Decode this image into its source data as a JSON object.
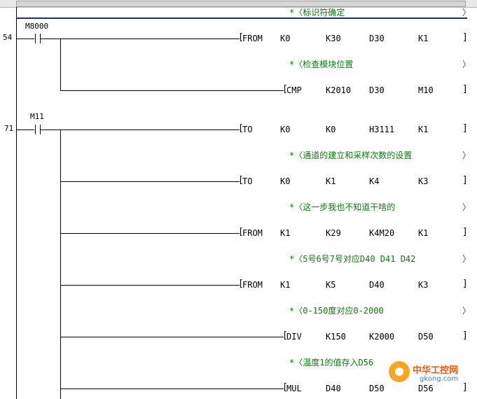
{
  "rungs": [
    {
      "step": "54",
      "contact": "M8000"
    },
    {
      "step": "71",
      "contact": "M11"
    }
  ],
  "comments": [
    "*〈标识符确定",
    "*〈检查模块位置",
    "*〈通道的建立和采样次数的设置",
    "*〈这一步我也不知道干啥的",
    "*〈5号6号7号对应D40 D41 D42",
    "*〈0-150度对应0-2000",
    "*〈温度1的值存入D56"
  ],
  "instructions": [
    {
      "op": "FROM",
      "args": [
        "K0",
        "K30",
        "D30",
        "K1"
      ]
    },
    {
      "op": "CMP",
      "args": [
        "K2010",
        "D30",
        "M10"
      ]
    },
    {
      "op": "TO",
      "args": [
        "K0",
        "K0",
        "H3111",
        "K1"
      ]
    },
    {
      "op": "TO",
      "args": [
        "K0",
        "K1",
        "K4",
        "K3"
      ]
    },
    {
      "op": "FROM",
      "args": [
        "K1",
        "K29",
        "K4M20",
        "K1"
      ]
    },
    {
      "op": "FROM",
      "args": [
        "K1",
        "K5",
        "D40",
        "K3"
      ]
    },
    {
      "op": "DIV",
      "args": [
        "K150",
        "K2000",
        "D50"
      ]
    },
    {
      "op": "MUL",
      "args": [
        "D40",
        "D50",
        "D56"
      ]
    }
  ],
  "watermark": {
    "name": "中华工控网",
    "url": "gkong.com"
  },
  "colors": {
    "comment": "#0a7a0a",
    "top_bar": "#1a2c8a",
    "logo": "#e05a10"
  }
}
